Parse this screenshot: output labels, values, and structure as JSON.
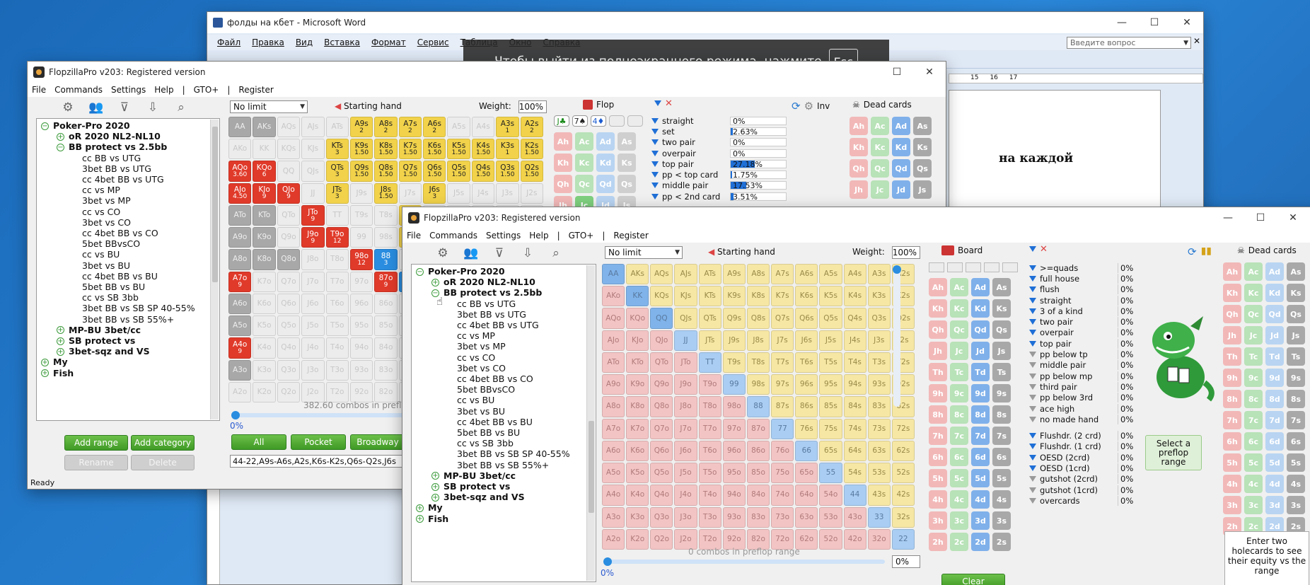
{
  "word": {
    "title": "фолды на кбет - Microsoft Word",
    "menu": [
      "Файл",
      "Правка",
      "Вид",
      "Вставка",
      "Формат",
      "Сервис",
      "Таблица",
      "Окно",
      "Справка"
    ],
    "search_placeholder": "Введите вопрос",
    "doc_text": "на каждой",
    "ruler_marks": [
      "15",
      "16",
      "17"
    ],
    "fullscreen_msg": "Чтобы выйти из полноэкранного режима, нажмите",
    "esc_key": "Esc"
  },
  "w1": {
    "title": "FlopzillaPro v203: Registered version",
    "menu": [
      "File",
      "Commands",
      "Settings",
      "Help",
      "|",
      "GTO+",
      "|",
      "Register"
    ],
    "tree": [
      {
        "label": "Poker-Pro 2020",
        "lvl": 1,
        "icon": "−",
        "bold": true
      },
      {
        "label": "oR 2020 NL2-NL10",
        "lvl": 2,
        "icon": "+",
        "bold": true
      },
      {
        "label": "BB protect vs 2.5bb",
        "lvl": 2,
        "icon": "−",
        "bold": true
      },
      {
        "label": "cc BB vs UTG",
        "lvl": 3
      },
      {
        "label": "3bet BB vs UTG",
        "lvl": 3
      },
      {
        "label": "cc 4bet BB vs UTG",
        "lvl": 3
      },
      {
        "label": "cc vs MP",
        "lvl": 3
      },
      {
        "label": "3bet vs MP",
        "lvl": 3
      },
      {
        "label": "cc vs CO",
        "lvl": 3
      },
      {
        "label": "3bet vs CO",
        "lvl": 3
      },
      {
        "label": "cc 4bet BB vs CO",
        "lvl": 3
      },
      {
        "label": "5bet BBvsCO",
        "lvl": 3
      },
      {
        "label": "cc vs BU",
        "lvl": 3
      },
      {
        "label": "3bet vs BU",
        "lvl": 3
      },
      {
        "label": "cc 4bet BB vs BU",
        "lvl": 3
      },
      {
        "label": "5bet BB vs BU",
        "lvl": 3
      },
      {
        "label": "cc vs SB 3bb",
        "lvl": 3
      },
      {
        "label": "3bet BB vs SB SP 40-55%",
        "lvl": 3
      },
      {
        "label": "3bet BB vs SB 55%+",
        "lvl": 3
      },
      {
        "label": "MP-BU 3bet/cc",
        "lvl": 2,
        "icon": "+",
        "bold": true
      },
      {
        "label": "SB protect vs",
        "lvl": 2,
        "icon": "+",
        "bold": true
      },
      {
        "label": "3bet-sqz and VS",
        "lvl": 2,
        "icon": "+",
        "bold": true
      },
      {
        "label": "My",
        "lvl": 1,
        "icon": "+",
        "bold": true
      },
      {
        "label": "Fish",
        "lvl": 1,
        "icon": "+",
        "bold": true
      }
    ],
    "add_range": "Add range",
    "add_category": "Add category",
    "rename": "Rename",
    "delete": "Delete",
    "status": "Ready",
    "game_type": "No limit",
    "starting_hand": "Starting hand",
    "weight_label": "Weight:",
    "weight": "100%",
    "combos": "382.60 combos in prefl",
    "slider_pct": "0%",
    "btn_all": "All",
    "btn_pocket": "Pocket",
    "btn_broadway": "Broadway",
    "range_text": "44-22,A9s-A6s,A2s,K6s-K2s,Q6s-Q2s,J6s",
    "flop_label": "Flop",
    "flop_cards": [
      "J♣",
      "7♠",
      "4♦"
    ],
    "inv_label": "Inv",
    "dead_cards": "Dead cards",
    "stats": [
      {
        "name": "straight",
        "pct": "0%",
        "bar": 0
      },
      {
        "name": "set",
        "pct": "2.63%",
        "bar": 2.63
      },
      {
        "name": "two pair",
        "pct": "0%",
        "bar": 0
      },
      {
        "name": "overpair",
        "pct": "0%",
        "bar": 0
      },
      {
        "name": "top pair",
        "pct": "27.18%",
        "bar": 27.18
      },
      {
        "name": "pp < top card",
        "pct": "1.75%",
        "bar": 1.75
      },
      {
        "name": "middle pair",
        "pct": "17.53%",
        "bar": 17.53
      },
      {
        "name": "pp < 2nd card",
        "pct": "3.51%",
        "bar": 3.51
      }
    ]
  },
  "w2": {
    "title": "FlopzillaPro v203: Registered version",
    "menu": [
      "File",
      "Commands",
      "Settings",
      "Help",
      "|",
      "GTO+",
      "|",
      "Register"
    ],
    "game_type": "No limit",
    "starting_hand": "Starting hand",
    "weight_label": "Weight:",
    "weight": "100%",
    "combos": "0 combos in preflop range",
    "slider_pct": "0%",
    "slider_pct2": "0%",
    "board_label": "Board",
    "dead_cards": "Dead cards",
    "select_range": "Select a preflop range",
    "clear": "Clear",
    "equity_hint": "Enter two holecards to see their equity vs the range",
    "stats": [
      {
        "name": ">=quads",
        "pct": "0%",
        "f": "blue"
      },
      {
        "name": "full house",
        "pct": "0%",
        "f": "blue"
      },
      {
        "name": "flush",
        "pct": "0%",
        "f": "blue"
      },
      {
        "name": "straight",
        "pct": "0%",
        "f": "blue"
      },
      {
        "name": "3 of a kind",
        "pct": "0%",
        "f": "blue"
      },
      {
        "name": "two pair",
        "pct": "0%",
        "f": "blue"
      },
      {
        "name": "overpair",
        "pct": "0%",
        "f": "blue"
      },
      {
        "name": "top pair",
        "pct": "0%",
        "f": "blue"
      },
      {
        "name": "pp below tp",
        "pct": "0%",
        "f": "gray"
      },
      {
        "name": "middle pair",
        "pct": "0%",
        "f": "gray"
      },
      {
        "name": "pp below mp",
        "pct": "0%",
        "f": "gray"
      },
      {
        "name": "third pair",
        "pct": "0%",
        "f": "gray"
      },
      {
        "name": "pp below 3rd",
        "pct": "0%",
        "f": "gray"
      },
      {
        "name": "ace high",
        "pct": "0%",
        "f": "gray"
      },
      {
        "name": "no made hand",
        "pct": "0%",
        "f": "gray"
      },
      {
        "name": "Flushdr. (2 crd)",
        "pct": "0%",
        "f": "blue"
      },
      {
        "name": "Flushdr. (1 crd)",
        "pct": "0%",
        "f": "blue"
      },
      {
        "name": "OESD (2crd)",
        "pct": "0%",
        "f": "blue"
      },
      {
        "name": "OESD (1crd)",
        "pct": "0%",
        "f": "blue"
      },
      {
        "name": "gutshot (2crd)",
        "pct": "0%",
        "f": "gray"
      },
      {
        "name": "gutshot (1crd)",
        "pct": "0%",
        "f": "gray"
      },
      {
        "name": "overcards",
        "pct": "0%",
        "f": "gray"
      }
    ]
  },
  "colors": {
    "pair": "#a9cdf3",
    "suited": "#f6e7a4",
    "offsuit": "#f3c4c4",
    "sel_yellow": "#f1d24a",
    "sel_red": "#e03a2a",
    "sel_blue": "#2a8de0",
    "sel_gray": "#a8a8a8",
    "green_btn": "#4aa82e"
  }
}
